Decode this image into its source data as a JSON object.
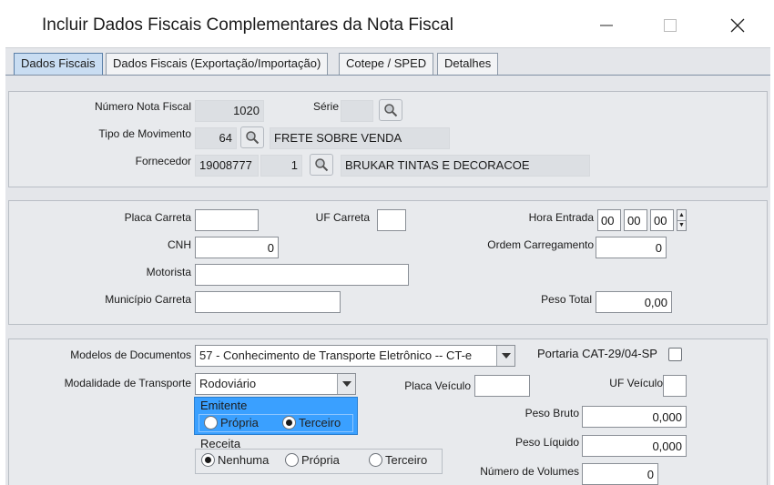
{
  "window": {
    "title": "Incluir Dados Fiscais Complementares da Nota Fiscal"
  },
  "tabs": [
    {
      "label": "Dados Fiscais"
    },
    {
      "label": "Dados Fiscais (Exportação/Importação)"
    },
    {
      "label": "Cotepe / SPED"
    },
    {
      "label": "Detalhes"
    }
  ],
  "nota": {
    "numero_label": "Número Nota Fiscal",
    "numero_value": "1020",
    "serie_label": "Série",
    "serie_value": "",
    "tipo_label": "Tipo de Movimento",
    "tipo_code": "64",
    "tipo_desc": "FRETE SOBRE VENDA",
    "fornecedor_label": "Fornecedor",
    "fornecedor_code": "19008777",
    "fornecedor_seq": "1",
    "fornecedor_name": "BRUKAR TINTAS E DECORACOE"
  },
  "transporte": {
    "placa_label": "Placa Carreta",
    "placa_value": "",
    "uf_carreta_label": "UF Carreta",
    "uf_carreta_value": "",
    "hora_label": "Hora Entrada",
    "hora_h": "00",
    "hora_m": "00",
    "hora_s": "00",
    "cnh_label": "CNH",
    "cnh_value": "0",
    "ordem_label": "Ordem Carregamento",
    "ordem_value": "0",
    "motorista_label": "Motorista",
    "motorista_value": "",
    "municipio_label": "Município Carreta",
    "municipio_value": "",
    "peso_total_label": "Peso Total",
    "peso_total_value": "0,00"
  },
  "documentos": {
    "modelos_label": "Modelos de Documentos",
    "modelos_value": "57 - Conhecimento de Transporte Eletrônico -- CT-e",
    "portaria_label": "Portaria CAT-29/04-SP",
    "modalidade_label": "Modalidade de Transporte",
    "modalidade_value": "Rodoviário",
    "emitente_label": "Emitente",
    "emitente_opt1": "Própria",
    "emitente_opt2": "Terceiro",
    "receita_label": "Receita",
    "receita_opt1": "Nenhuma",
    "receita_opt2": "Própria",
    "receita_opt3": "Terceiro",
    "placa_veiculo_label": "Placa Veículo",
    "placa_veiculo_value": "",
    "uf_veiculo_label": "UF Veículo",
    "uf_veiculo_value": "",
    "peso_bruto_label": "Peso Bruto",
    "peso_bruto_value": "0,000",
    "peso_liquido_label": "Peso Líquido",
    "peso_liquido_value": "0,000",
    "volumes_label": "Número de Volumes",
    "volumes_value": "0"
  },
  "colors": {
    "tab_active": "#c9ddf2",
    "emitente_highlight": "#3aa0ff",
    "panel": "#e8eaed"
  }
}
